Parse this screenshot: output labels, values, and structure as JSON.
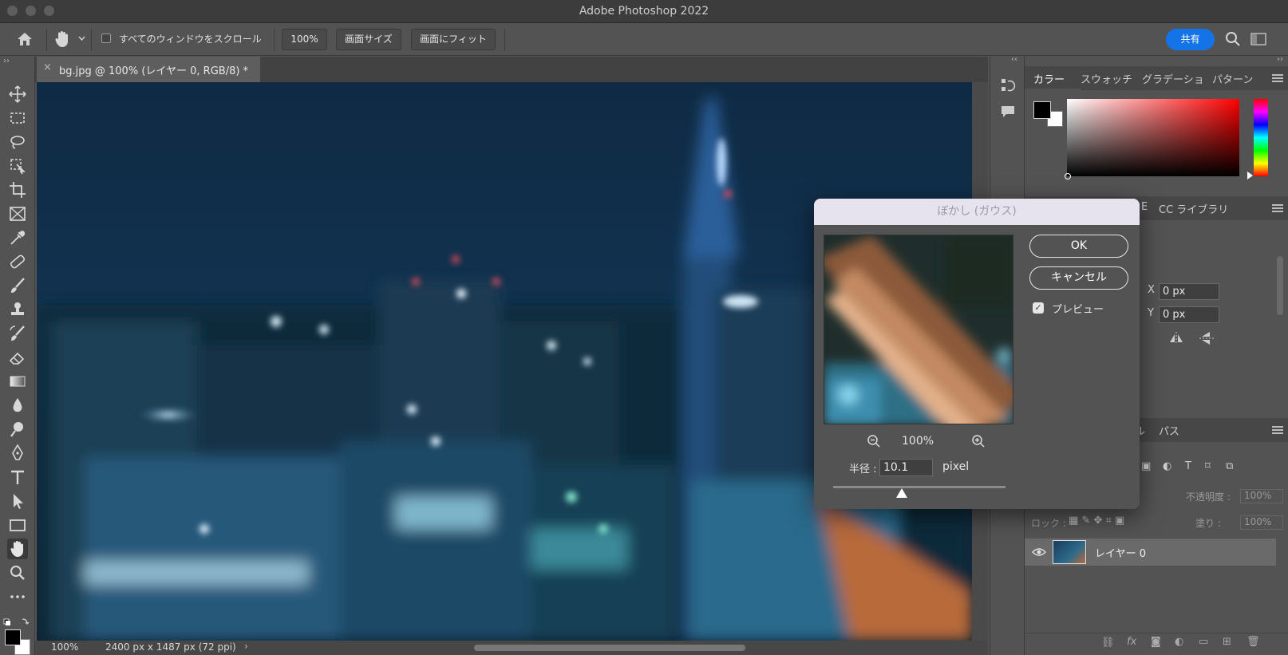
{
  "window": {
    "title": "Adobe Photoshop 2022"
  },
  "options_bar": {
    "scroll_all_label": "すべてのウィンドウをスクロール",
    "zoom_button": "100%",
    "screen_size_button": "画面サイズ",
    "fit_screen_button": "画面にフィット",
    "share_button": "共有"
  },
  "document": {
    "tab_title": "bg.jpg @ 100% (レイヤー 0, RGB/8) *",
    "status_zoom": "100%",
    "status_info": "2400 px x 1487 px (72 ppi)"
  },
  "color_panel": {
    "tabs": [
      "カラー",
      "スウォッチ",
      "グラデーショ",
      "パターン"
    ],
    "active_tab": "カラー",
    "foreground": "#000000",
    "background": "#ffffff",
    "accent_hue": "#ff0000"
  },
  "properties_panel": {
    "tabs": [
      "E",
      "CC ライブラリ"
    ],
    "x_label": "X",
    "x_value": "0 px",
    "y_label": "Y",
    "y_value": "0 px"
  },
  "layers_panel": {
    "tabs": [
      "ル",
      "パス"
    ],
    "opacity_label": "不透明度 :",
    "opacity_value": "100%",
    "lock_label": "ロック :",
    "fill_label": "塗り :",
    "fill_value": "100%",
    "layer_name": "レイヤー 0"
  },
  "dialog": {
    "title": "ぼかし (ガウス)",
    "ok": "OK",
    "cancel": "キャンセル",
    "preview_label": "プレビュー",
    "preview_checked": true,
    "zoom": "100%",
    "radius_label": "半径 :",
    "radius_value": "10.1",
    "radius_unit": "pixel",
    "radius_slider_fraction": 0.4
  },
  "tools": [
    "move-icon",
    "marquee-icon",
    "lasso-icon",
    "object-select-icon",
    "crop-icon",
    "frame-icon",
    "eyedropper-icon",
    "healing-icon",
    "brush-icon",
    "stamp-icon",
    "history-brush-icon",
    "eraser-icon",
    "gradient-icon",
    "blur-icon",
    "dodge-icon",
    "pen-icon",
    "type-icon",
    "path-select-icon",
    "rectangle-icon",
    "hand-icon",
    "zoom-icon",
    "more-tools-icon"
  ]
}
